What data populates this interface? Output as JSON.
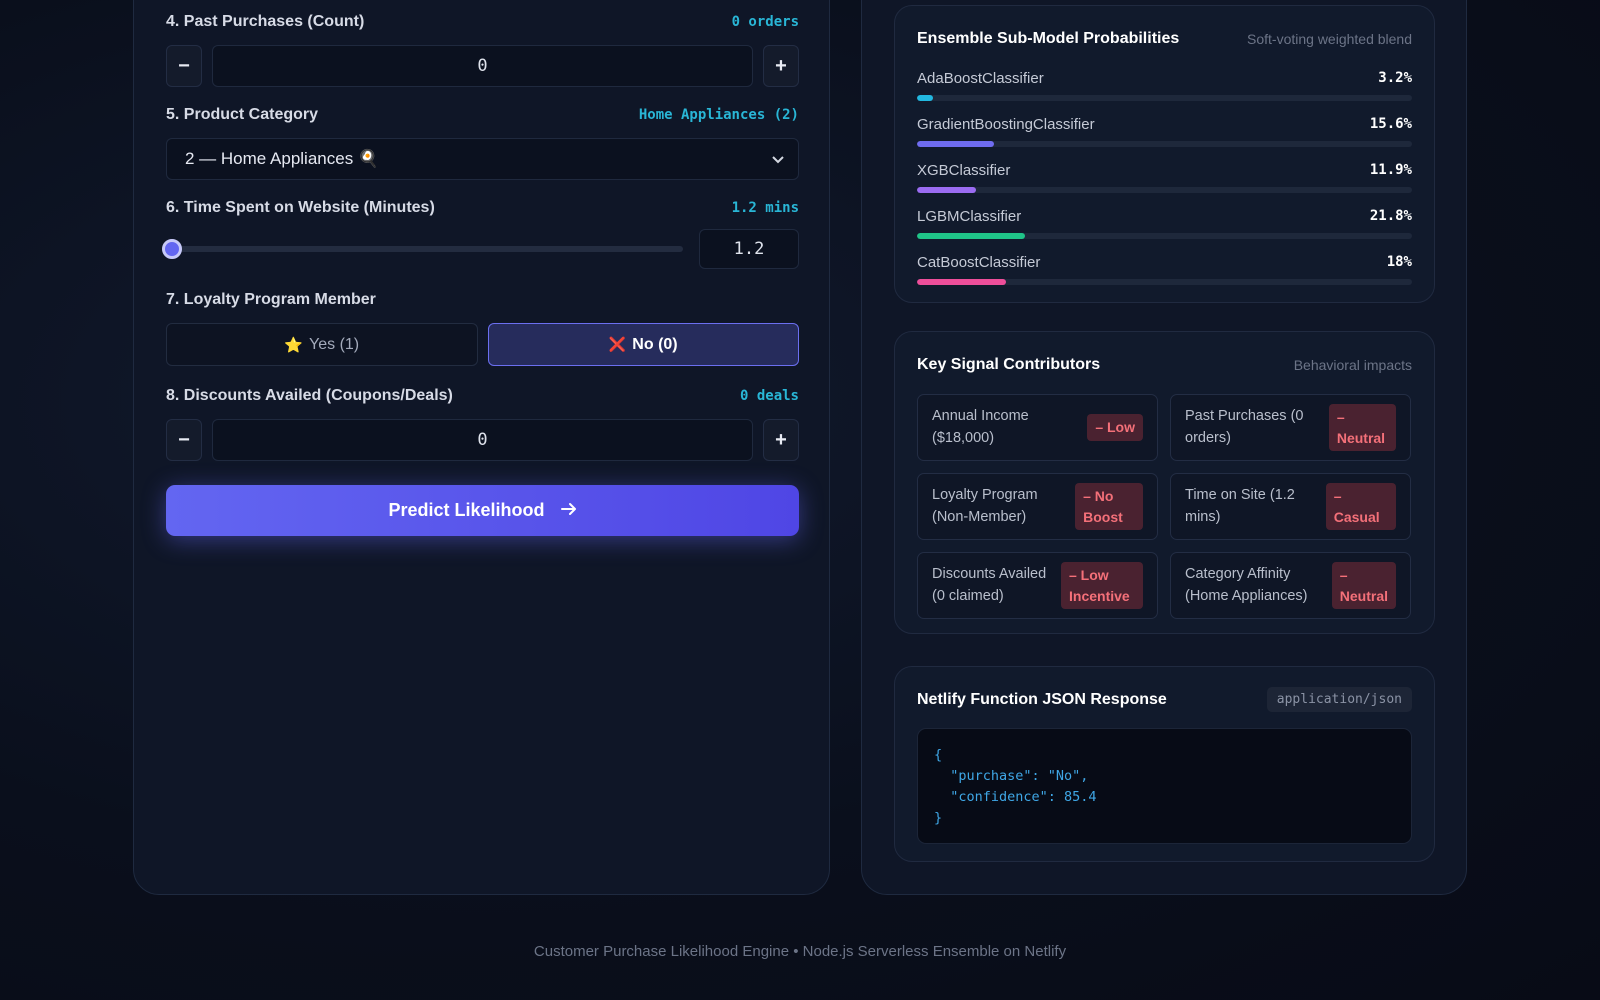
{
  "form": {
    "past_purchases": {
      "label": "4. Past Purchases (Count)",
      "value_tag": "0 orders",
      "minus": "−",
      "plus": "+",
      "value": "0"
    },
    "product_category": {
      "label": "5. Product Category",
      "value_tag": "Home Appliances (2)",
      "selected": "2 — Home Appliances 🍳",
      "chevron": "⌄"
    },
    "time_spent": {
      "label": "6. Time Spent on Website (Minutes)",
      "value_tag": "1.2 mins",
      "value": "1.2",
      "slider_fraction": 0.0
    },
    "loyalty": {
      "label": "7. Loyalty Program Member",
      "yes_icon": "⭐",
      "yes_label": "Yes (1)",
      "no_icon": "❌",
      "no_label": "No (0)",
      "selected": "no"
    },
    "discounts": {
      "label": "8. Discounts Availed (Coupons/Deals)",
      "value_tag": "0 deals",
      "minus": "−",
      "plus": "+",
      "value": "0"
    },
    "predict_button": {
      "label": "Predict Likelihood",
      "icon": "→"
    }
  },
  "ensemble": {
    "title": "Ensemble Sub-Model Probabilities",
    "subtitle": "Soft-voting weighted blend",
    "models": [
      {
        "name": "AdaBoostClassifier",
        "pct_label": "3.2%",
        "value": 3.2,
        "color": "#22b8e0"
      },
      {
        "name": "GradientBoostingClassifier",
        "pct_label": "15.6%",
        "value": 15.6,
        "color": "#6f6cf0"
      },
      {
        "name": "XGBClassifier",
        "pct_label": "11.9%",
        "value": 11.9,
        "color": "#9b6cf2"
      },
      {
        "name": "LGBMClassifier",
        "pct_label": "21.8%",
        "value": 21.8,
        "color": "#1fc488"
      },
      {
        "name": "CatBoostClassifier",
        "pct_label": "18%",
        "value": 18,
        "color": "#ee4e9a"
      }
    ]
  },
  "signals": {
    "title": "Key Signal Contributors",
    "subtitle": "Behavioral impacts",
    "items": [
      {
        "label": "Annual Income ($18,000)",
        "badge": "– Low"
      },
      {
        "label": "Past Purchases (0 orders)",
        "badge": "– Neutral"
      },
      {
        "label": "Loyalty Program (Non-Member)",
        "badge": "– No Boost"
      },
      {
        "label": "Time on Site (1.2 mins)",
        "badge": "– Casual"
      },
      {
        "label": "Discounts Availed (0 claimed)",
        "badge": "– Low Incentive"
      },
      {
        "label": "Category Affinity (Home Appliances)",
        "badge": "– Neutral"
      }
    ]
  },
  "json_response": {
    "title": "Netlify Function JSON Response",
    "mime": "application/json",
    "lines": [
      "{",
      "  \"purchase\": \"No\",",
      "  \"confidence\": 85.4",
      "}"
    ]
  },
  "footer": {
    "text": "Customer Purchase Likelihood Engine • Node.js Serverless Ensemble on Netlify"
  }
}
